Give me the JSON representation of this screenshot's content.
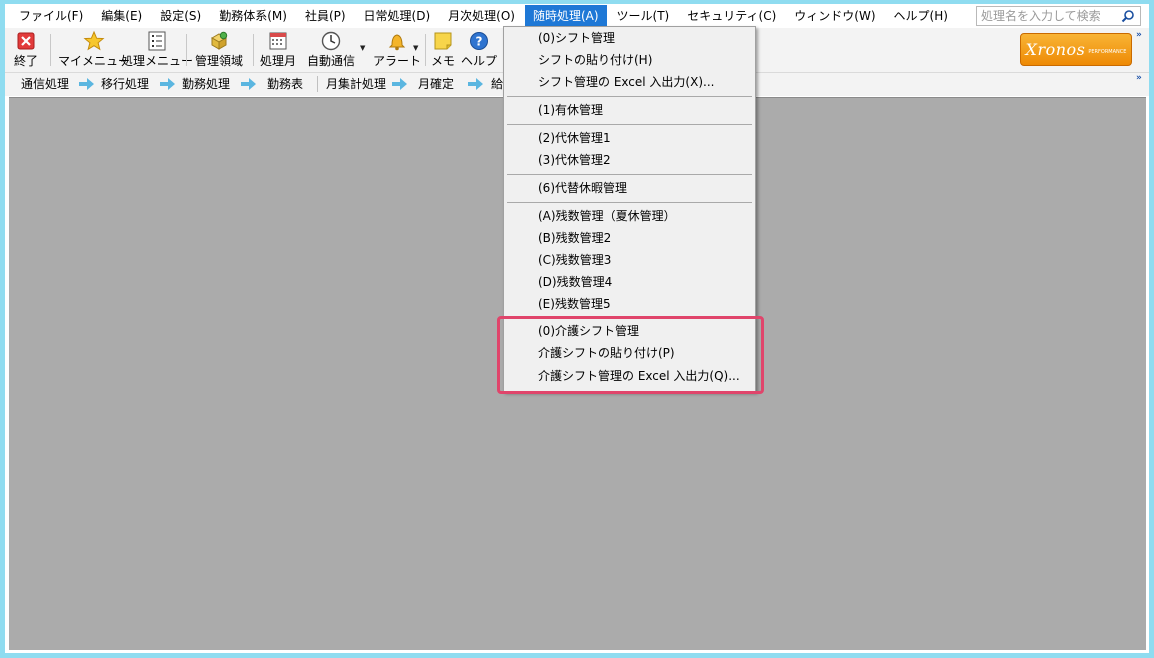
{
  "menubar": {
    "items": [
      {
        "label": "ファイル(F)"
      },
      {
        "label": "編集(E)"
      },
      {
        "label": "設定(S)"
      },
      {
        "label": "勤務体系(M)"
      },
      {
        "label": "社員(P)"
      },
      {
        "label": "日常処理(D)"
      },
      {
        "label": "月次処理(O)"
      },
      {
        "label": "随時処理(A)",
        "active": true
      },
      {
        "label": "ツール(T)"
      },
      {
        "label": "セキュリティ(C)"
      },
      {
        "label": "ウィンドウ(W)"
      },
      {
        "label": "ヘルプ(H)"
      }
    ],
    "search_placeholder": "処理名を入力して検索"
  },
  "toolbar": {
    "buttons": [
      {
        "label": "終了",
        "icon": "close-red-x-icon"
      },
      {
        "label": "マイメニュー",
        "icon": "star-icon"
      },
      {
        "label": "処理メニュー",
        "icon": "list-menu-icon"
      },
      {
        "label": "管理領域",
        "icon": "management-area-icon"
      },
      {
        "label": "処理月",
        "icon": "calendar-icon"
      },
      {
        "label": "自動通信",
        "icon": "clock-icon"
      },
      {
        "label": "アラート",
        "icon": "bell-icon"
      },
      {
        "label": "メモ",
        "icon": "sticky-note-icon"
      },
      {
        "label": "ヘルプ",
        "icon": "help-question-icon"
      }
    ],
    "logo": {
      "brand": "Xronos",
      "sub": "PERFORMANCE"
    }
  },
  "flowbar": {
    "items": [
      "通信処理",
      "移行処理",
      "勤務処理",
      "勤務表",
      "月集計処理",
      "月確定",
      "給"
    ]
  },
  "dropdown": {
    "items": [
      "(0)シフト管理",
      "シフトの貼り付け(H)",
      "シフト管理の Excel 入出力(X)...",
      "(1)有休管理",
      "(2)代休管理1",
      "(3)代休管理2",
      "(6)代替休暇管理",
      "(A)残数管理（夏休管理）",
      "(B)残数管理2",
      "(C)残数管理3",
      "(D)残数管理4",
      "(E)残数管理5",
      "(0)介護シフト管理",
      "介護シフトの貼り付け(P)",
      "介護シフト管理の Excel 入出力(Q)..."
    ]
  },
  "colors": {
    "accent": "#1e78d6",
    "highlight": "#e0456b",
    "workspace": "#ababab",
    "frame": "#8fdcf0",
    "logo": "#f29a10"
  }
}
